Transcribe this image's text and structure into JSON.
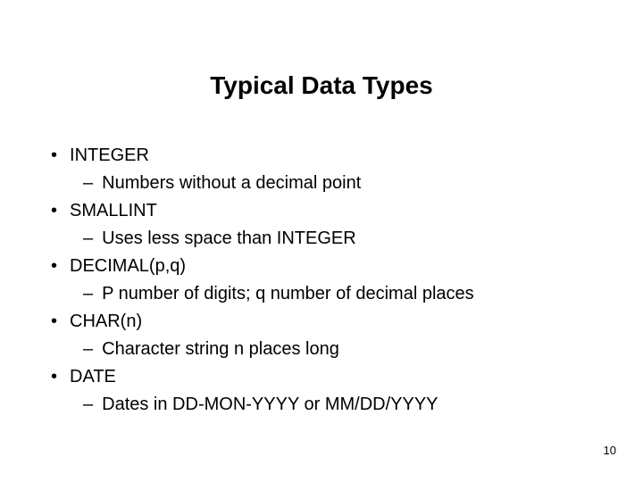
{
  "title": "Typical Data Types",
  "items": [
    {
      "label": "INTEGER",
      "sub": "Numbers without a decimal point"
    },
    {
      "label": "SMALLINT",
      "sub": "Uses less space than INTEGER"
    },
    {
      "label": "DECIMAL(p,q)",
      "sub": "P number of digits; q number of decimal places"
    },
    {
      "label": "CHAR(n)",
      "sub": "Character string n places long"
    },
    {
      "label": "DATE",
      "sub": "Dates in DD-MON-YYYY or MM/DD/YYYY"
    }
  ],
  "pageNumber": "10"
}
